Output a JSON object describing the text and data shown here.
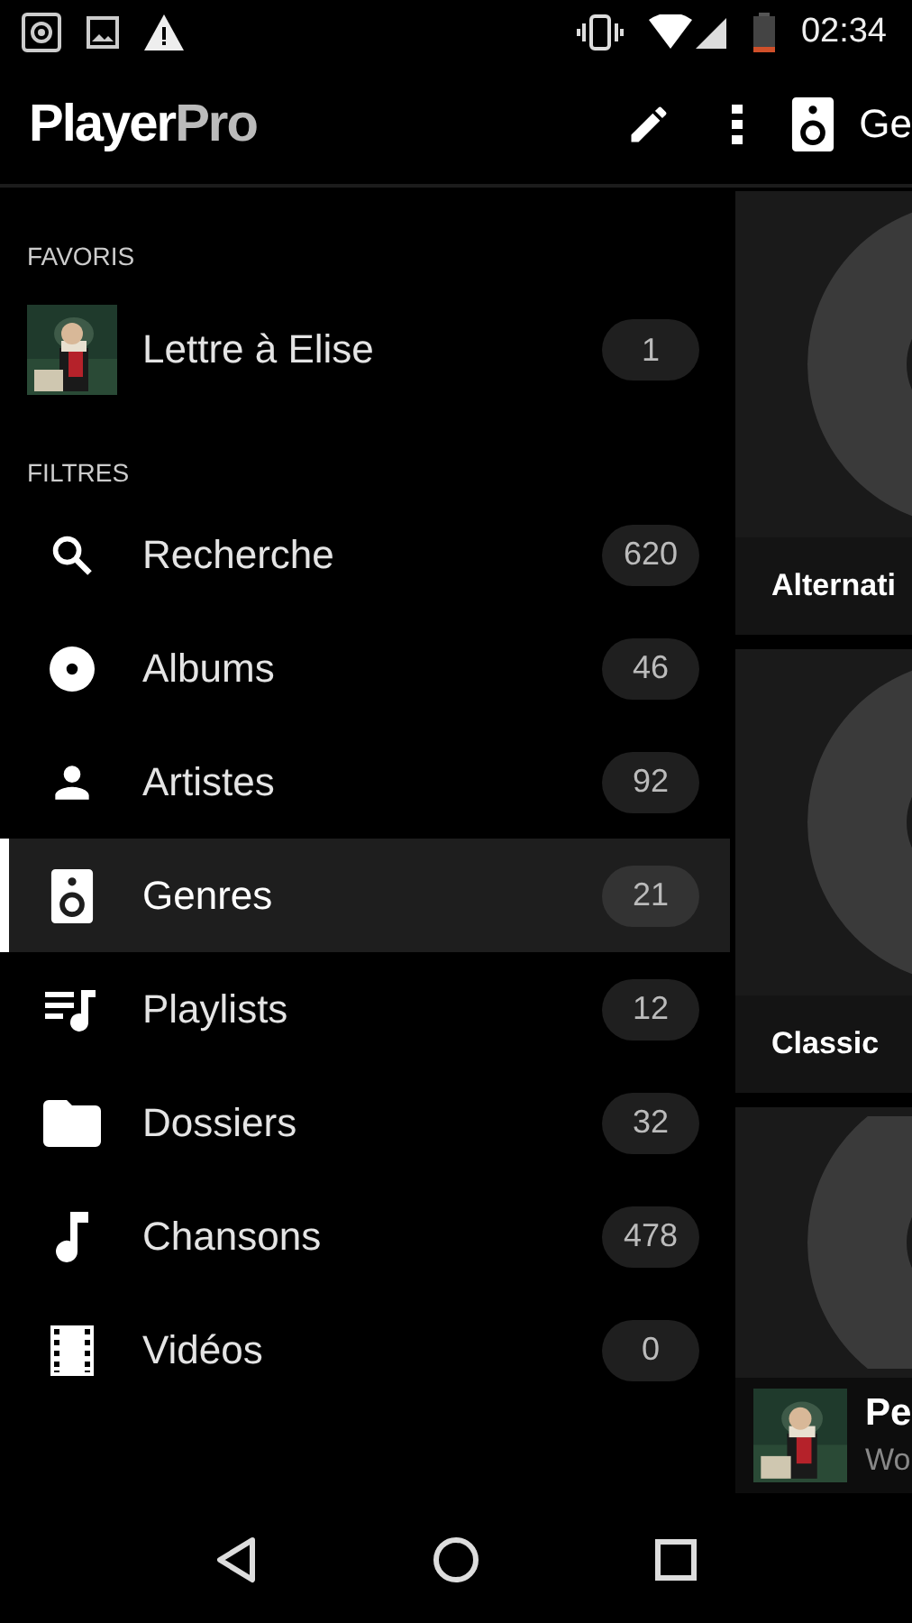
{
  "status_bar": {
    "time": "02:34"
  },
  "toolbar": {
    "logo": {
      "main": "Player",
      "accent": "Pro"
    },
    "title": "Ge"
  },
  "drawer": {
    "sections": [
      {
        "header": "FAVORIS",
        "items": [
          {
            "kind": "favorite",
            "label": "Lettre à Elise",
            "count": "1",
            "selected": false
          }
        ]
      },
      {
        "header": "FILTRES",
        "items": [
          {
            "kind": "search",
            "label": "Recherche",
            "count": "620",
            "selected": false
          },
          {
            "kind": "album",
            "label": "Albums",
            "count": "46",
            "selected": false
          },
          {
            "kind": "artist",
            "label": "Artistes",
            "count": "92",
            "selected": false
          },
          {
            "kind": "genre",
            "label": "Genres",
            "count": "21",
            "selected": true
          },
          {
            "kind": "playlist",
            "label": "Playlists",
            "count": "12",
            "selected": false
          },
          {
            "kind": "folder",
            "label": "Dossiers",
            "count": "32",
            "selected": false
          },
          {
            "kind": "song",
            "label": "Chansons",
            "count": "478",
            "selected": false
          },
          {
            "kind": "video",
            "label": "Vidéos",
            "count": "0",
            "selected": false
          }
        ]
      }
    ]
  },
  "genre_cards": [
    {
      "kind": "full",
      "label": "Alternati"
    },
    {
      "kind": "full",
      "label": "Classic"
    },
    {
      "kind": "partial"
    }
  ],
  "now_playing": {
    "title": "Pe",
    "subtitle": "Wo"
  }
}
